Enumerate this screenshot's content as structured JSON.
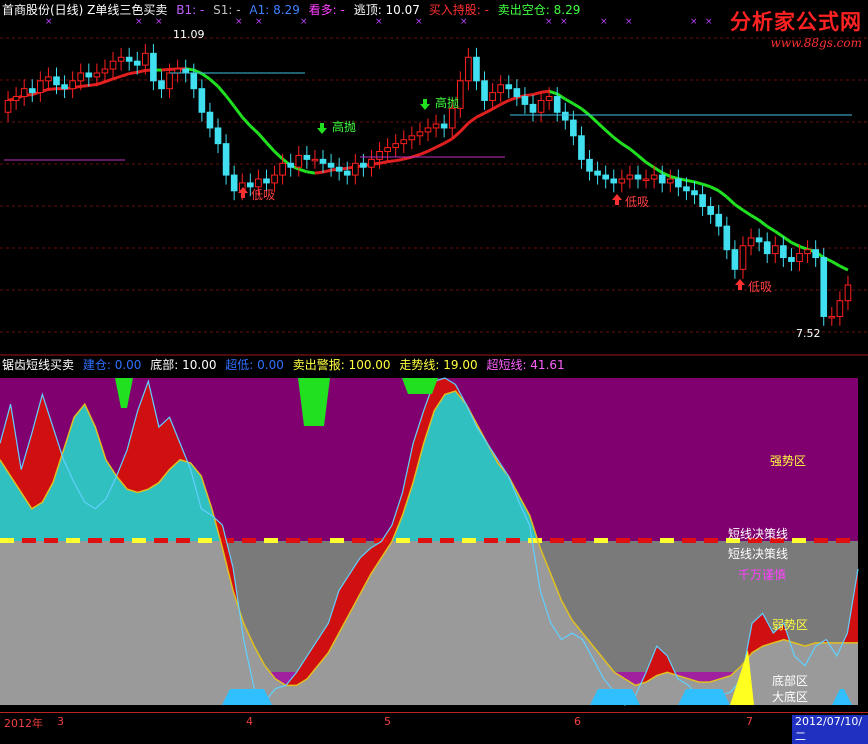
{
  "top_header": {
    "title": "首商股份(日线) Z单线三色买卖",
    "b1": "B1: -",
    "s1": "S1: -",
    "a1": "A1: 8.29",
    "kanduo": "看多: -",
    "taoding": "逃顶: 10.07",
    "mairu": "买入持股: -",
    "maichu": "卖出空仓: 8.29"
  },
  "brand": {
    "name": "分析家公式网",
    "url": "www.88gs.com"
  },
  "bottom_header": {
    "title": "锯齿短线买卖",
    "jiancang": "建仓: 0.00",
    "dibu": "底部: 10.00",
    "chaodie": "超低: 0.00",
    "maichu_jingbao": "卖出警报: 100.00",
    "zoushixian": "走势线: 19.00",
    "chaoduanxian": "超短线: 41.61"
  },
  "annotations": {
    "high_price": "11.09",
    "low_price": "7.52",
    "buy_label": "低吸",
    "sell_label": "高抛"
  },
  "zones": {
    "strong_top": "强势区",
    "decision_line_1": "短线决策线",
    "decision_line_2": "短线决策线",
    "careful": "千万谨慎",
    "strong_bottom": "弱势区",
    "bottom_zone": "底部区",
    "big_bottom": "大底区"
  },
  "axis": {
    "year": "2012年",
    "months": [
      "3",
      "4",
      "5",
      "6",
      "7"
    ],
    "last_date": "2012/07/10/二"
  },
  "colors": {
    "up": "#ff2020",
    "down": "#40e0f0",
    "ma_red": "#e02020",
    "ma_green": "#20e020",
    "zone_magenta": "#800070",
    "zone_gray": "#7a7a7a",
    "zone_cyan": "#30c0c0"
  },
  "chart_data": [
    {
      "type": "candlestick",
      "title": "首商股份(日线) Z单线三色买卖",
      "ylim": [
        7.3,
        11.4
      ],
      "x": [
        1,
        2,
        3,
        4,
        5,
        6,
        7,
        8,
        9,
        10,
        11,
        12,
        13,
        14,
        15,
        16,
        17,
        18,
        19,
        20,
        21,
        22,
        23,
        24,
        25,
        26,
        27,
        28,
        29,
        30,
        31,
        32,
        33,
        34,
        35,
        36,
        37,
        38,
        39,
        40,
        41,
        42,
        43,
        44,
        45,
        46,
        47,
        48,
        49,
        50,
        51,
        52,
        53,
        54,
        55,
        56,
        57,
        58,
        59,
        60,
        61,
        62,
        63,
        64,
        65,
        66,
        67,
        68,
        69,
        70,
        71,
        72,
        73,
        74,
        75,
        76,
        77,
        78,
        79,
        80,
        81,
        82,
        83,
        84,
        85,
        86,
        87,
        88,
        89,
        90,
        91,
        92,
        93,
        94,
        95,
        96,
        97,
        98,
        99,
        100,
        101,
        102,
        103,
        104,
        105
      ],
      "open": [
        10.2,
        10.35,
        10.4,
        10.5,
        10.45,
        10.6,
        10.65,
        10.55,
        10.5,
        10.6,
        10.7,
        10.65,
        10.7,
        10.75,
        10.85,
        10.9,
        10.85,
        10.8,
        10.95,
        10.6,
        10.5,
        10.7,
        10.75,
        10.7,
        10.5,
        10.2,
        10.0,
        9.8,
        9.4,
        9.2,
        9.3,
        9.25,
        9.35,
        9.3,
        9.4,
        9.55,
        9.5,
        9.65,
        9.6,
        9.6,
        9.55,
        9.5,
        9.45,
        9.4,
        9.55,
        9.5,
        9.6,
        9.7,
        9.75,
        9.8,
        9.85,
        9.9,
        9.95,
        10.0,
        10.05,
        10.0,
        10.25,
        10.6,
        10.9,
        10.6,
        10.35,
        10.45,
        10.55,
        10.5,
        10.4,
        10.3,
        10.2,
        10.35,
        10.4,
        10.2,
        10.1,
        9.9,
        9.6,
        9.45,
        9.4,
        9.35,
        9.3,
        9.35,
        9.4,
        9.35,
        9.35,
        9.4,
        9.3,
        9.35,
        9.25,
        9.2,
        9.15,
        9.0,
        8.9,
        8.75,
        8.45,
        8.2,
        8.5,
        8.6,
        8.55,
        8.4,
        8.5,
        8.35,
        8.3,
        8.4,
        8.45,
        8.35,
        7.6,
        7.6,
        7.8
      ],
      "close": [
        10.35,
        10.4,
        10.5,
        10.45,
        10.6,
        10.65,
        10.55,
        10.5,
        10.6,
        10.7,
        10.65,
        10.7,
        10.75,
        10.85,
        10.9,
        10.85,
        10.8,
        10.95,
        10.6,
        10.5,
        10.7,
        10.75,
        10.7,
        10.5,
        10.2,
        10.0,
        9.8,
        9.4,
        9.2,
        9.3,
        9.25,
        9.35,
        9.3,
        9.4,
        9.55,
        9.5,
        9.65,
        9.6,
        9.6,
        9.55,
        9.5,
        9.45,
        9.4,
        9.55,
        9.5,
        9.6,
        9.7,
        9.75,
        9.8,
        9.85,
        9.9,
        9.95,
        10.0,
        10.05,
        10.0,
        10.25,
        10.6,
        10.9,
        10.6,
        10.35,
        10.45,
        10.55,
        10.5,
        10.4,
        10.3,
        10.2,
        10.35,
        10.4,
        10.2,
        10.1,
        9.9,
        9.6,
        9.45,
        9.4,
        9.35,
        9.3,
        9.35,
        9.4,
        9.35,
        9.35,
        9.4,
        9.3,
        9.35,
        9.25,
        9.2,
        9.15,
        9.0,
        8.9,
        8.75,
        8.45,
        8.2,
        8.5,
        8.6,
        8.55,
        8.4,
        8.5,
        8.35,
        8.3,
        8.4,
        8.45,
        8.35,
        7.6,
        7.6,
        7.8,
        8.0
      ],
      "high_label": "11.09",
      "low_label": "7.52"
    },
    {
      "type": "area",
      "title": "锯齿短线买卖",
      "ylim": [
        0,
        100
      ],
      "series": [
        {
          "name": "超短线",
          "values": [
            80,
            92,
            72,
            83,
            95,
            85,
            75,
            68,
            62,
            60,
            63,
            70,
            78,
            90,
            99,
            85,
            88,
            80,
            72,
            60,
            58,
            55,
            42,
            20,
            5,
            1,
            5,
            6,
            10,
            15,
            20,
            25,
            35,
            40,
            45,
            48,
            50,
            55,
            65,
            80,
            90,
            99,
            100,
            98,
            92,
            85,
            80,
            75,
            70,
            62,
            55,
            35,
            25,
            20,
            22,
            20,
            14,
            8,
            4,
            0,
            3,
            10,
            18,
            15,
            8,
            6,
            2,
            1,
            3,
            4,
            8,
            25,
            28,
            22,
            25,
            15,
            12,
            18,
            20,
            15,
            22,
            41.61
          ]
        },
        {
          "name": "走势线",
          "values": [
            75,
            70,
            65,
            60,
            62,
            68,
            78,
            88,
            92,
            85,
            75,
            70,
            66,
            65,
            66,
            68,
            72,
            75,
            74,
            70,
            60,
            48,
            35,
            25,
            18,
            12,
            8,
            6,
            6,
            8,
            12,
            16,
            22,
            28,
            34,
            40,
            45,
            50,
            58,
            68,
            80,
            90,
            95,
            96,
            92,
            86,
            80,
            74,
            70,
            64,
            58,
            48,
            40,
            32,
            26,
            22,
            18,
            14,
            10,
            8,
            6,
            7,
            9,
            10,
            9,
            8,
            7,
            7,
            8,
            9,
            12,
            16,
            18,
            19,
            20,
            19,
            18,
            19,
            19,
            19,
            19,
            19
          ]
        }
      ]
    }
  ]
}
